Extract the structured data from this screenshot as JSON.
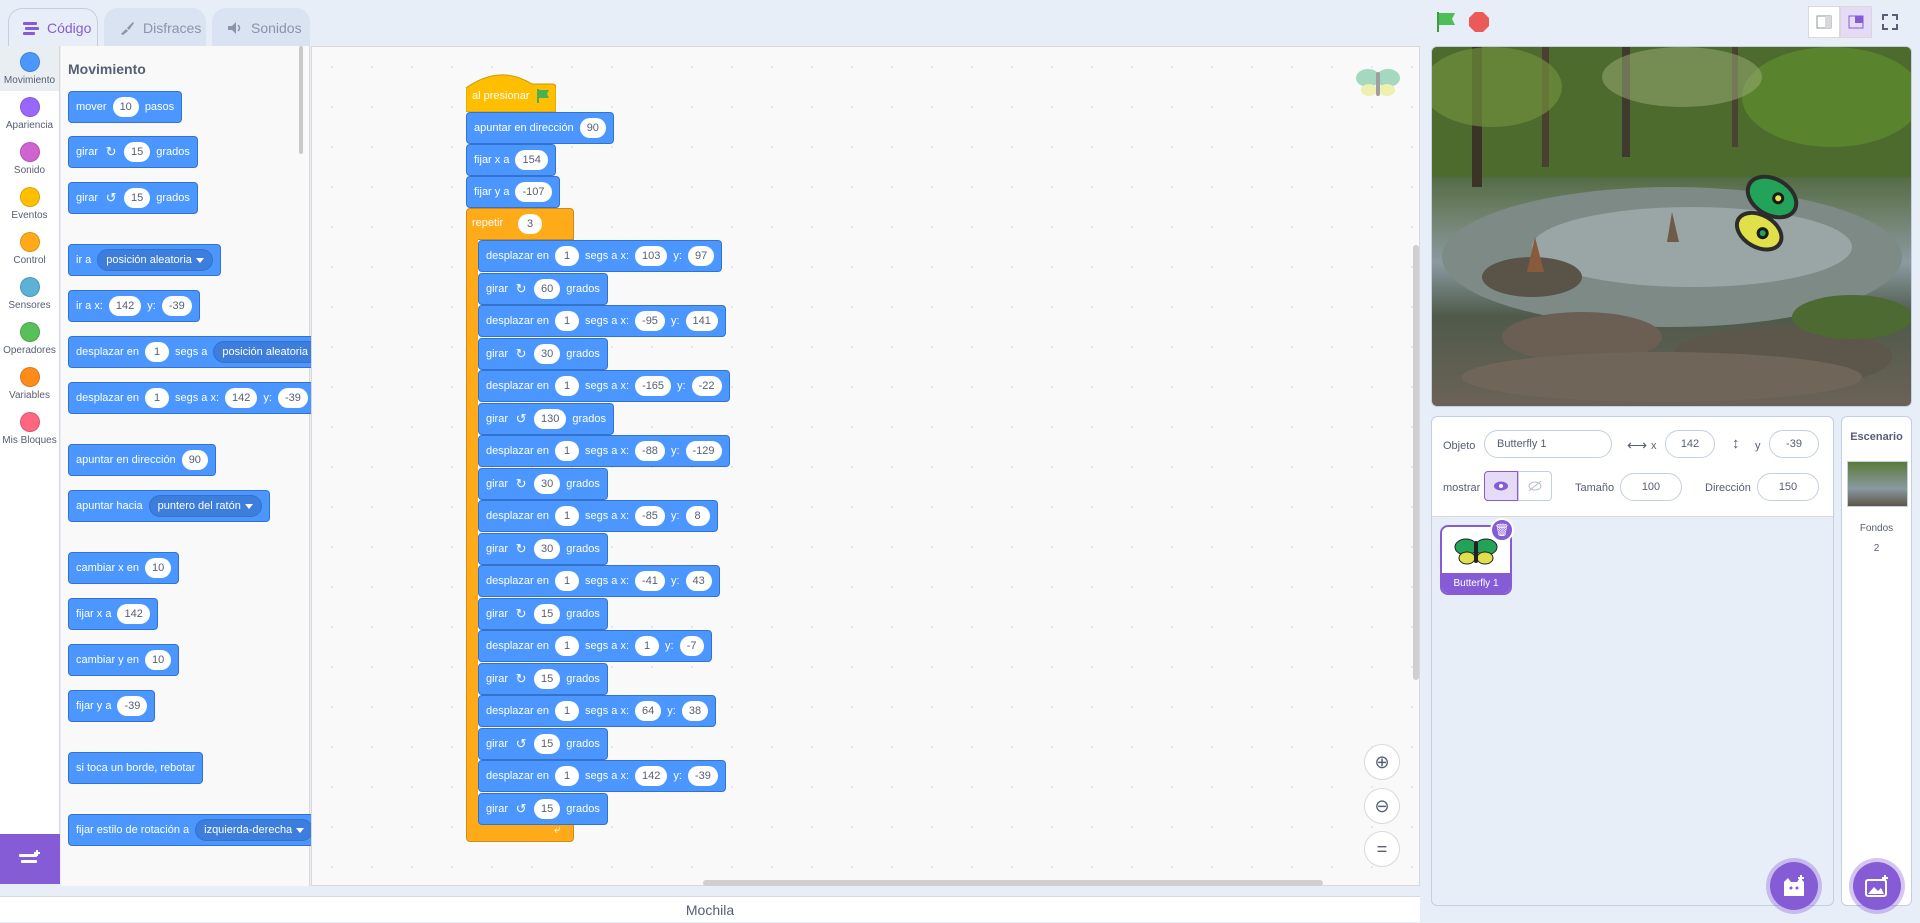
{
  "tabs": [
    {
      "label": "Código",
      "icon": "code-icon"
    },
    {
      "label": "Disfraces",
      "icon": "brush-icon"
    },
    {
      "label": "Sonidos",
      "icon": "speaker-icon"
    }
  ],
  "categories": [
    {
      "label": "Movimiento",
      "color": "#4c97ff"
    },
    {
      "label": "Apariencia",
      "color": "#9966ff"
    },
    {
      "label": "Sonido",
      "color": "#cf63cf"
    },
    {
      "label": "Eventos",
      "color": "#ffbf00"
    },
    {
      "label": "Control",
      "color": "#ffab19"
    },
    {
      "label": "Sensores",
      "color": "#5cb1d6"
    },
    {
      "label": "Operadores",
      "color": "#59c059"
    },
    {
      "label": "Variables",
      "color": "#ff8c1a"
    },
    {
      "label": "Mis Bloques",
      "color": "#ff6680"
    }
  ],
  "palette": {
    "title": "Movimiento",
    "move": {
      "a": "mover",
      "v": "10",
      "b": "pasos"
    },
    "turn_right": {
      "a": "girar",
      "v": "15",
      "b": "grados"
    },
    "turn_left": {
      "a": "girar",
      "v": "15",
      "b": "grados"
    },
    "goto": {
      "a": "ir a",
      "dd": "posición aleatoria"
    },
    "goto_xy": {
      "a": "ir a x:",
      "x": "142",
      "b": "y:",
      "y": "-39"
    },
    "glide": {
      "a": "desplazar en",
      "v": "1",
      "b": "segs a",
      "dd": "posición aleatoria"
    },
    "glide_xy": {
      "a": "desplazar en",
      "v": "1",
      "b": "segs a x:",
      "x": "142",
      "c": "y:",
      "y": "-39"
    },
    "point_dir": {
      "a": "apuntar en dirección",
      "v": "90"
    },
    "point_towards": {
      "a": "apuntar hacia",
      "dd": "puntero del ratón"
    },
    "change_x": {
      "a": "cambiar x en",
      "v": "10"
    },
    "set_x": {
      "a": "fijar x a",
      "v": "142"
    },
    "change_y": {
      "a": "cambiar y en",
      "v": "10"
    },
    "set_y": {
      "a": "fijar y a",
      "v": "-39"
    },
    "bounce": {
      "a": "si toca un borde, rebotar"
    },
    "rotation": {
      "a": "fijar estilo de rotación a",
      "dd": "izquierda-derecha"
    }
  },
  "script": {
    "hat": "al presionar",
    "point": {
      "a": "apuntar en dirección",
      "v": "90"
    },
    "setx": {
      "a": "fijar x a",
      "v": "154"
    },
    "sety": {
      "a": "fijar y a",
      "v": "-107"
    },
    "repeat": {
      "a": "repetir",
      "v": "3"
    },
    "inner": [
      {
        "kind": "glide",
        "a": "desplazar en",
        "v": "1",
        "b": "segs a x:",
        "x": "103",
        "c": "y:",
        "y": "97"
      },
      {
        "kind": "turn_r",
        "a": "girar",
        "v": "60",
        "b": "grados"
      },
      {
        "kind": "glide",
        "a": "desplazar en",
        "v": "1",
        "b": "segs a x:",
        "x": "-95",
        "c": "y:",
        "y": "141"
      },
      {
        "kind": "turn_r",
        "a": "girar",
        "v": "30",
        "b": "grados"
      },
      {
        "kind": "glide",
        "a": "desplazar en",
        "v": "1",
        "b": "segs a x:",
        "x": "-165",
        "c": "y:",
        "y": "-22"
      },
      {
        "kind": "turn_l",
        "a": "girar",
        "v": "130",
        "b": "grados"
      },
      {
        "kind": "glide",
        "a": "desplazar en",
        "v": "1",
        "b": "segs a x:",
        "x": "-88",
        "c": "y:",
        "y": "-129"
      },
      {
        "kind": "turn_r",
        "a": "girar",
        "v": "30",
        "b": "grados"
      },
      {
        "kind": "glide",
        "a": "desplazar en",
        "v": "1",
        "b": "segs a x:",
        "x": "-85",
        "c": "y:",
        "y": "8"
      },
      {
        "kind": "turn_r",
        "a": "girar",
        "v": "30",
        "b": "grados"
      },
      {
        "kind": "glide",
        "a": "desplazar en",
        "v": "1",
        "b": "segs a x:",
        "x": "-41",
        "c": "y:",
        "y": "43"
      },
      {
        "kind": "turn_r",
        "a": "girar",
        "v": "15",
        "b": "grados"
      },
      {
        "kind": "glide",
        "a": "desplazar en",
        "v": "1",
        "b": "segs a x:",
        "x": "1",
        "c": "y:",
        "y": "-7"
      },
      {
        "kind": "turn_r",
        "a": "girar",
        "v": "15",
        "b": "grados"
      },
      {
        "kind": "glide",
        "a": "desplazar en",
        "v": "1",
        "b": "segs a x:",
        "x": "64",
        "c": "y:",
        "y": "38"
      },
      {
        "kind": "turn_l",
        "a": "girar",
        "v": "15",
        "b": "grados"
      },
      {
        "kind": "glide",
        "a": "desplazar en",
        "v": "1",
        "b": "segs a x:",
        "x": "142",
        "c": "y:",
        "y": "-39"
      },
      {
        "kind": "turn_l",
        "a": "girar",
        "v": "15",
        "b": "grados"
      }
    ]
  },
  "mochila": "Mochila",
  "sprite_info": {
    "objeto_label": "Objeto",
    "name": "Butterfly 1",
    "x_label": "x",
    "x": "142",
    "y_label": "y",
    "y": "-39",
    "show_label": "mostrar",
    "size_label": "Tamaño",
    "size": "100",
    "dir_label": "Dirección",
    "dir": "150"
  },
  "sprite_tile": {
    "name": "Butterfly 1"
  },
  "backdrop": {
    "title": "Escenario",
    "fondos_label": "Fondos",
    "fondos_count": "2"
  },
  "colors": {
    "accent": "#855cd6",
    "motion": "#4c97ff",
    "control": "#ffab19",
    "event": "#ffbf00"
  }
}
